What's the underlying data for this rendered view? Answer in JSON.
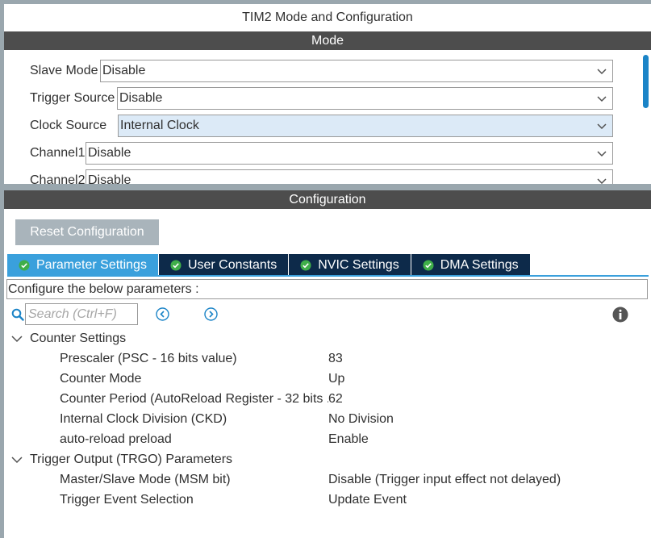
{
  "window": {
    "title": "TIM2 Mode and Configuration"
  },
  "mode": {
    "header": "Mode",
    "rows": [
      {
        "label": "Slave Mode",
        "value": "Disable"
      },
      {
        "label": "Trigger Source",
        "value": "Disable"
      },
      {
        "label": "Clock Source",
        "value": "Internal Clock"
      },
      {
        "label": "Channel1",
        "value": "Disable"
      },
      {
        "label": "Channel2",
        "value": "Disable"
      }
    ]
  },
  "configuration": {
    "header": "Configuration",
    "reset_label": "Reset Configuration",
    "tabs": [
      {
        "label": "Parameter Settings"
      },
      {
        "label": "User Constants"
      },
      {
        "label": "NVIC Settings"
      },
      {
        "label": "DMA Settings"
      }
    ],
    "description": "Configure the below parameters :",
    "search_placeholder": "Search (Ctrl+F)",
    "groups": [
      {
        "name": "Counter Settings",
        "params": [
          {
            "name": "Prescaler (PSC - 16 bits value)",
            "value": "83"
          },
          {
            "name": "Counter Mode",
            "value": "Up"
          },
          {
            "name": "Counter Period (AutoReload Register - 32 bits ..",
            "value": "62"
          },
          {
            "name": "Internal Clock Division (CKD)",
            "value": "No Division"
          },
          {
            "name": "auto-reload preload",
            "value": "Enable"
          }
        ]
      },
      {
        "name": "Trigger Output (TRGO) Parameters",
        "params": [
          {
            "name": "Master/Slave Mode (MSM bit)",
            "value": "Disable (Trigger input effect not delayed)"
          },
          {
            "name": "Trigger Event Selection",
            "value": "Update Event"
          }
        ]
      }
    ]
  },
  "colors": {
    "section_header": "#4d4d4d",
    "tab_active": "#3aa0dc",
    "tab_inactive": "#0d2a4a",
    "tab_check": "#3fae49",
    "accent": "#1b84c7",
    "select_highlight": "#dceaf7",
    "reset_button": "#a9b4bb"
  },
  "icons": {
    "select": "chevron-down-icon",
    "tab_status": "check-circle-icon",
    "search": "search-icon",
    "prev": "arrow-left-circle-icon",
    "next": "arrow-right-circle-icon",
    "info": "info-icon",
    "group_toggle": "chevron-down-icon"
  }
}
